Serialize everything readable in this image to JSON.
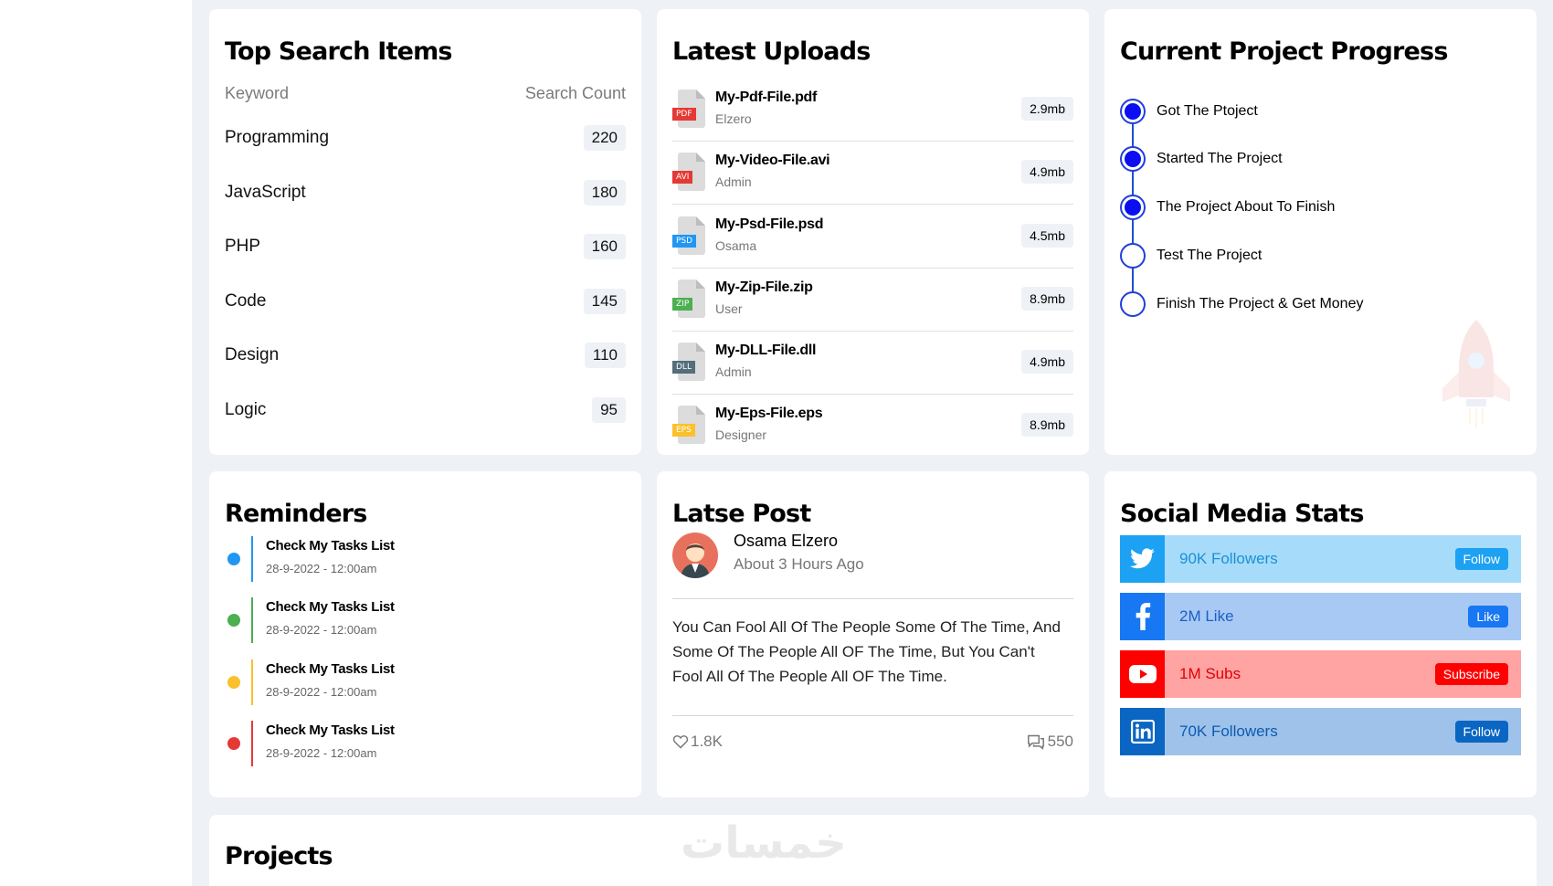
{
  "top_search": {
    "title": "Top Search Items",
    "col_keyword": "Keyword",
    "col_count": "Search Count",
    "rows": [
      {
        "keyword": "Programming",
        "count": "220"
      },
      {
        "keyword": "JavaScript",
        "count": "180"
      },
      {
        "keyword": "PHP",
        "count": "160"
      },
      {
        "keyword": "Code",
        "count": "145"
      },
      {
        "keyword": "Design",
        "count": "110"
      },
      {
        "keyword": "Logic",
        "count": "95"
      }
    ]
  },
  "uploads": {
    "title": "Latest Uploads",
    "files": [
      {
        "name": "My-Pdf-File.pdf",
        "by": "Elzero",
        "size": "2.9mb",
        "tag": "PDF",
        "color": "#e53935"
      },
      {
        "name": "My-Video-File.avi",
        "by": "Admin",
        "size": "4.9mb",
        "tag": "AVI",
        "color": "#e53935"
      },
      {
        "name": "My-Psd-File.psd",
        "by": "Osama",
        "size": "4.5mb",
        "tag": "PSD",
        "color": "#2196f3"
      },
      {
        "name": "My-Zip-File.zip",
        "by": "User",
        "size": "8.9mb",
        "tag": "ZIP",
        "color": "#4caf50"
      },
      {
        "name": "My-DLL-File.dll",
        "by": "Admin",
        "size": "4.9mb",
        "tag": "DLL",
        "color": "#546e7a"
      },
      {
        "name": "My-Eps-File.eps",
        "by": "Designer",
        "size": "8.9mb",
        "tag": "EPS",
        "color": "#fbc02d"
      }
    ]
  },
  "progress": {
    "title": "Current Project Progress",
    "steps": [
      {
        "label": "Got The Ptoject",
        "done": true
      },
      {
        "label": "Started The Project",
        "done": true
      },
      {
        "label": "The Project About To Finish",
        "done": true
      },
      {
        "label": "Test The Project",
        "done": false
      },
      {
        "label": "Finish The Project & Get Money",
        "done": false
      }
    ]
  },
  "reminders": {
    "title": "Reminders",
    "items": [
      {
        "title": "Check My Tasks List",
        "date": "28-9-2022 - 12:00am",
        "color": "#2196f3"
      },
      {
        "title": "Check My Tasks List",
        "date": "28-9-2022 - 12:00am",
        "color": "#4caf50"
      },
      {
        "title": "Check My Tasks List",
        "date": "28-9-2022 - 12:00am",
        "color": "#fbc02d"
      },
      {
        "title": "Check My Tasks List",
        "date": "28-9-2022 - 12:00am",
        "color": "#e53935"
      }
    ]
  },
  "post": {
    "title": "Latse Post",
    "author": "Osama Elzero",
    "time": "About 3 Hours Ago",
    "text": "You Can Fool All Of The People Some Of The Time, And Some Of The People All OF The Time, But You Can't Fool All Of The People All OF The Time.",
    "likes": "1.8K",
    "comments": "550"
  },
  "social": {
    "title": "Social Media Stats",
    "items": [
      {
        "network": "twitter",
        "text": "90K Followers",
        "button": "Follow",
        "icon_bg": "#1da1f2",
        "bg": "#a6dcfa",
        "btn_bg": "#1da1f2",
        "text_color": "#1d8fd6"
      },
      {
        "network": "facebook",
        "text": "2M Like",
        "button": "Like",
        "icon_bg": "#1877f2",
        "bg": "#a9c9f5",
        "btn_bg": "#1877f2",
        "text_color": "#1a5fc6"
      },
      {
        "network": "youtube",
        "text": "1M Subs",
        "button": "Subscribe",
        "icon_bg": "#ff0000",
        "bg": "#ffa3a3",
        "btn_bg": "#ff0000",
        "text_color": "#e00000"
      },
      {
        "network": "linkedin",
        "text": "70K Followers",
        "button": "Follow",
        "icon_bg": "#0a66c2",
        "bg": "#9fc2ea",
        "btn_bg": "#0a66c2",
        "text_color": "#0a5cb0"
      }
    ]
  },
  "projects": {
    "title": "Projects"
  },
  "watermark": "خمسات"
}
